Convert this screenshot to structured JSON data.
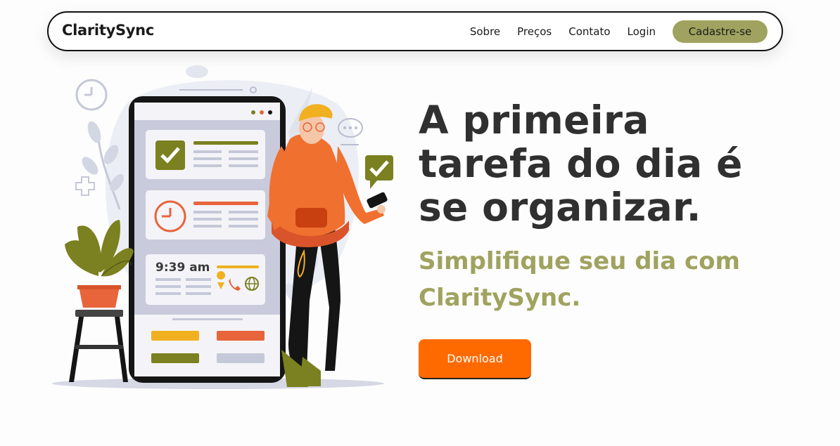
{
  "nav": {
    "brand": "ClaritySync",
    "links": [
      "Sobre",
      "Preços",
      "Contato",
      "Login"
    ],
    "signup_label": "Cadastre-se"
  },
  "hero": {
    "headline": "A primeira tarefa do dia é se organizar.",
    "subheadline": "Simplifique seu dia com ClaritySync.",
    "download_label": "Download"
  },
  "illustration": {
    "phone_time": "9:39 am"
  },
  "colors": {
    "accent_olive": "#a0a35f",
    "accent_orange": "#ff6a00",
    "text_dark": "#303030"
  }
}
